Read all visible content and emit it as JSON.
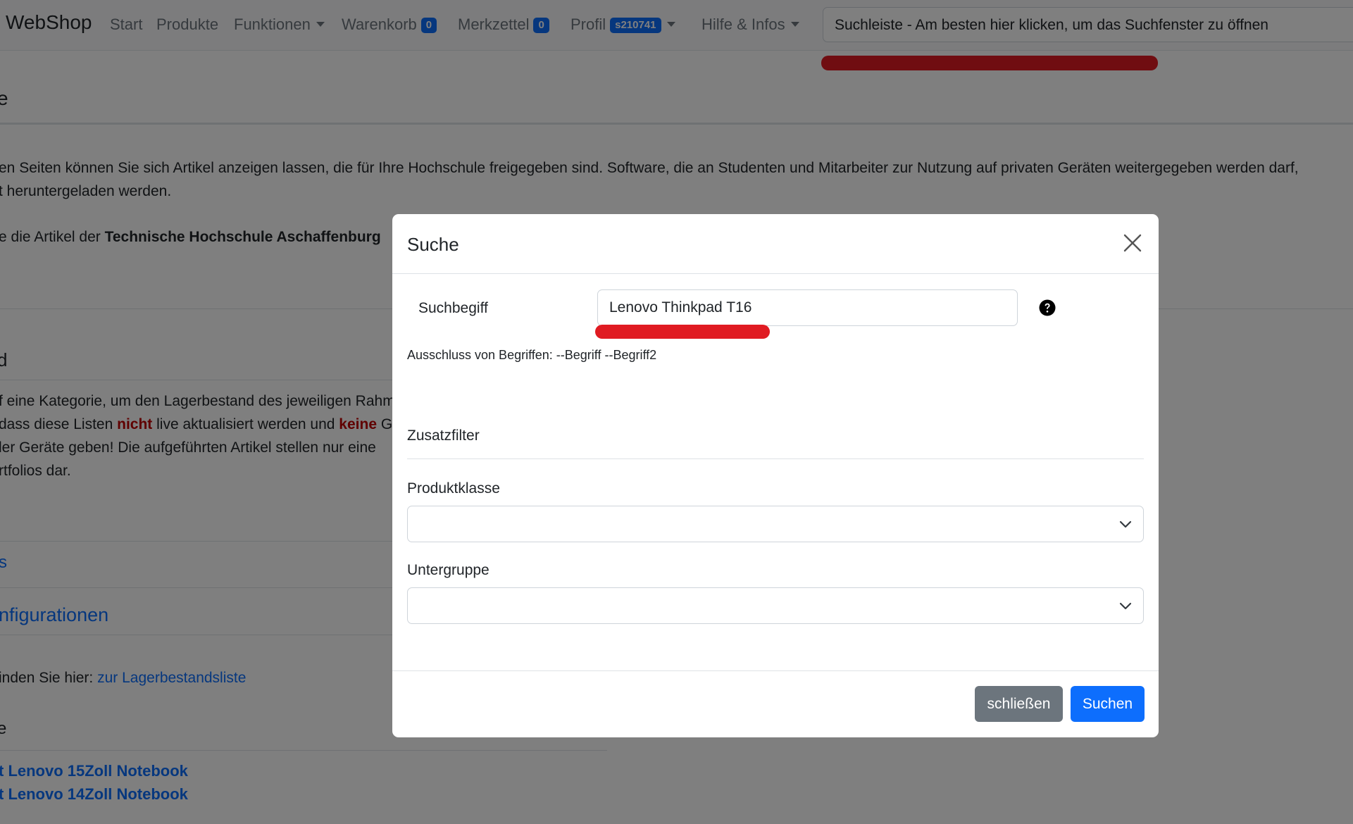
{
  "navbar": {
    "brand": "WebShop",
    "items": {
      "start": "Start",
      "produkte": "Produkte",
      "funktionen": "Funktionen",
      "warenkorb": "Warenkorb",
      "warenkorb_count": "0",
      "merkzettel": "Merkzettel",
      "merkzettel_count": "0",
      "profil": "Profil",
      "profil_user": "s210741",
      "hilfe": "Hilfe & Infos"
    },
    "search_bar": "Suchleiste - Am besten hier klicken, um das Suchfenster zu öffnen"
  },
  "page": {
    "heading1": "e",
    "intro_line1": "en Seiten können Sie sich Artikel anzeigen lassen, die für Ihre Hochschule freigegeben sind. Software, die an Studenten und Mitarbeiter zur Nutzung auf privaten Geräten weitergegeben werden darf,",
    "intro_line2": "t heruntergeladen werden.",
    "university_prefix": "e die Artikel der",
    "university_name": "Technische Hochschule Aschaffenburg",
    "heading2": "d",
    "stock_line1": "f eine Kategorie, um den Lagerbestand des jeweiligen Rahm",
    "stock_line2_a": "dass diese Listen",
    "stock_line2_nicht": "nicht",
    "stock_line2_b": "live aktualisiert werden und",
    "stock_line2_keine": "keine",
    "stock_line2_c": "G",
    "stock_line3": "ler Geräte geben! Die aufgeführten Artikel stellen nur eine",
    "stock_line4": "rtfolios dar.",
    "link_s": "s",
    "link_konfigurationen": "nfigurationen",
    "stock_list_prefix": "inden Sie hier:",
    "stock_list_link": "zur Lagerbestandsliste",
    "heading3": "e",
    "product_link1": "t Lenovo 15Zoll Notebook",
    "product_link2": "t Lenovo 14Zoll Notebook"
  },
  "modal": {
    "title": "Suche",
    "search_label": "Suchbegiff",
    "search_value": "Lenovo Thinkpad T16",
    "hint": "Ausschluss von Begriffen: --Begriff --Begriff2",
    "extra_filter_title": "Zusatzfilter",
    "product_class_label": "Produktklasse",
    "product_class_value": "",
    "subgroup_label": "Untergruppe",
    "subgroup_value": "",
    "close_label": "schließen",
    "search_button": "Suchen"
  },
  "colors": {
    "primary": "#0d6efd",
    "secondary": "#6c757d",
    "annotation_red": "#e01b22"
  },
  "icons": [
    "chevron-down-icon",
    "close-icon",
    "help-icon"
  ]
}
